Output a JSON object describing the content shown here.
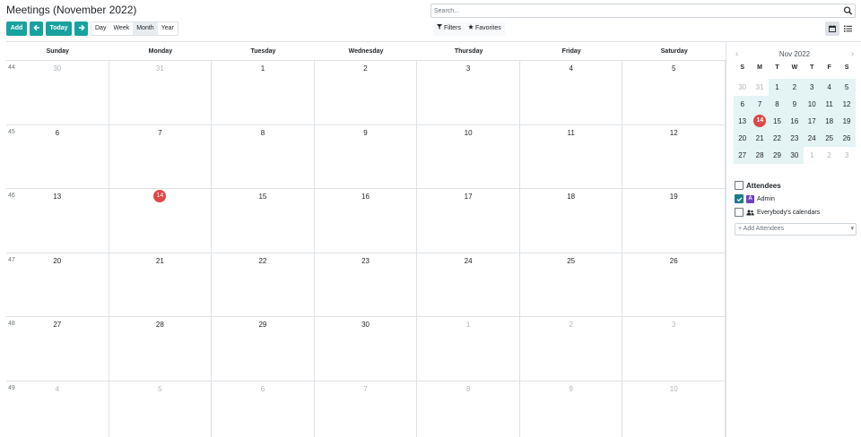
{
  "header": {
    "title": "Meetings (November 2022)",
    "search_placeholder": "Search...",
    "filters_label": "Filters",
    "favorites_label": "Favorites"
  },
  "toolbar": {
    "add_label": "Add",
    "today_label": "Today",
    "scales": [
      "Day",
      "Week",
      "Month",
      "Year"
    ],
    "active_scale": "Month"
  },
  "calendar": {
    "weekdays": [
      "Sunday",
      "Monday",
      "Tuesday",
      "Wednesday",
      "Thursday",
      "Friday",
      "Saturday"
    ],
    "weeks": [
      {
        "num": "44",
        "days": [
          "30",
          "31",
          "1",
          "2",
          "3",
          "4",
          "5"
        ]
      },
      {
        "num": "45",
        "days": [
          "6",
          "7",
          "8",
          "9",
          "10",
          "11",
          "12"
        ]
      },
      {
        "num": "46",
        "days": [
          "13",
          "14",
          "15",
          "16",
          "17",
          "18",
          "19"
        ]
      },
      {
        "num": "47",
        "days": [
          "20",
          "21",
          "22",
          "23",
          "24",
          "25",
          "26"
        ]
      },
      {
        "num": "48",
        "days": [
          "27",
          "28",
          "29",
          "30",
          "1",
          "2",
          "3"
        ]
      },
      {
        "num": "49",
        "days": [
          "4",
          "5",
          "6",
          "7",
          "8",
          "9",
          "10"
        ]
      }
    ],
    "today": "14"
  },
  "mini_calendar": {
    "title": "Nov 2022",
    "prev": "‹",
    "next": "›",
    "dow": [
      "S",
      "M",
      "T",
      "W",
      "T",
      "F",
      "S"
    ],
    "weeks": [
      [
        "30",
        "31",
        "1",
        "2",
        "3",
        "4",
        "5"
      ],
      [
        "6",
        "7",
        "8",
        "9",
        "10",
        "11",
        "12"
      ],
      [
        "13",
        "14",
        "15",
        "16",
        "17",
        "18",
        "19"
      ],
      [
        "20",
        "21",
        "22",
        "23",
        "24",
        "25",
        "26"
      ],
      [
        "27",
        "28",
        "29",
        "30",
        "1",
        "2",
        "3"
      ]
    ]
  },
  "attendees": {
    "title": "Attendees",
    "items": [
      {
        "label": "Admin",
        "avatar": "A",
        "checked": true
      },
      {
        "label": "Everybody's calendars",
        "checked": false
      }
    ],
    "add_placeholder": "+ Add Attendees"
  },
  "colors": {
    "primary": "#17a2a0",
    "today": "#e04848",
    "mini_highlight": "#e4f3f4",
    "avatar": "#6f42c1"
  }
}
